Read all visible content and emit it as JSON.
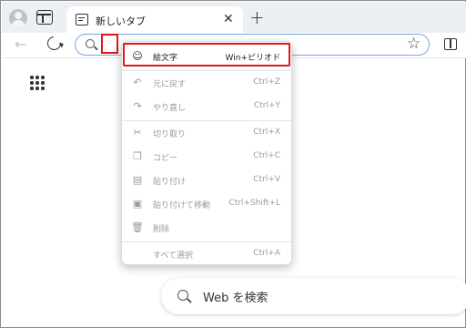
{
  "tab": {
    "title": "新しいタブ"
  },
  "page": {
    "search_placeholder": "Web を検索"
  },
  "context_menu": {
    "items": [
      {
        "label": "絵文字",
        "shortcut": "Win+ピリオド",
        "enabled": true,
        "icon": "smiley-icon"
      },
      {
        "label": "元に戻す",
        "shortcut": "Ctrl+Z",
        "enabled": false,
        "icon": "undo-icon"
      },
      {
        "label": "やり直し",
        "shortcut": "Ctrl+Y",
        "enabled": false,
        "icon": "redo-icon"
      },
      {
        "label": "切り取り",
        "shortcut": "Ctrl+X",
        "enabled": false,
        "icon": "scissors-icon"
      },
      {
        "label": "コピー",
        "shortcut": "Ctrl+C",
        "enabled": false,
        "icon": "copy-icon"
      },
      {
        "label": "貼り付け",
        "shortcut": "Ctrl+V",
        "enabled": false,
        "icon": "paste-icon"
      },
      {
        "label": "貼り付けて移動",
        "shortcut": "Ctrl+Shift+L",
        "enabled": false,
        "icon": "paste-go-icon"
      },
      {
        "label": "削除",
        "shortcut": "",
        "enabled": false,
        "icon": "trash-icon"
      },
      {
        "label": "すべて選択",
        "shortcut": "Ctrl+A",
        "enabled": false,
        "icon": ""
      }
    ]
  },
  "colors": {
    "highlight": "#e4141b",
    "address_focus": "#7aa7e0",
    "disabled_text": "#9a9a9a"
  }
}
